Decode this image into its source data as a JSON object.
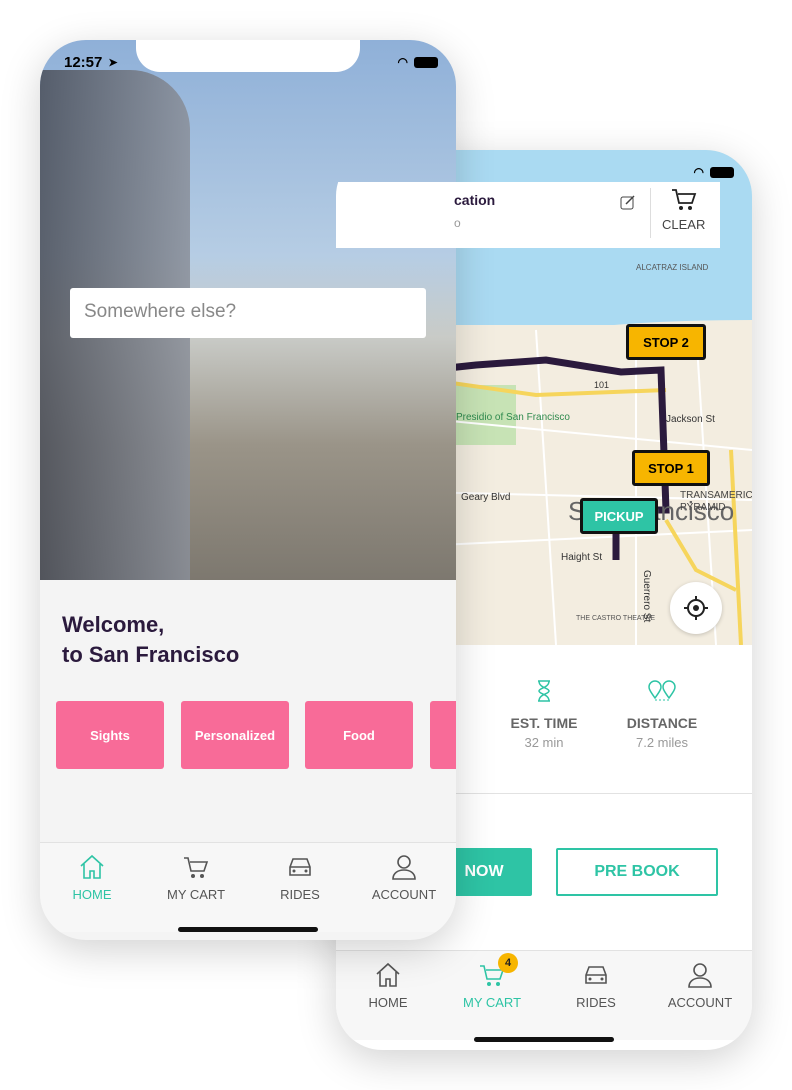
{
  "colors": {
    "accent": "#2ec4a5",
    "pill": "#f86b98",
    "marker_stop": "#f7b500",
    "route": "#2b1a3d"
  },
  "front": {
    "status": {
      "time": "12:57"
    },
    "search": {
      "placeholder": "Somewhere else?"
    },
    "welcome": {
      "line1": "Welcome,",
      "line2": "to San Francisco"
    },
    "categories": [
      "Sights",
      "Personalized",
      "Food"
    ],
    "tabs": [
      {
        "label": "HOME",
        "icon": "home-icon",
        "active": true
      },
      {
        "label": "MY CART",
        "icon": "cart-icon"
      },
      {
        "label": "RIDES",
        "icon": "car-icon"
      },
      {
        "label": "ACCOUNT",
        "icon": "user-icon"
      }
    ]
  },
  "back": {
    "header": {
      "title": "cation",
      "subtitle": "o",
      "clear": "CLEAR"
    },
    "map": {
      "labels": [
        "ALCATRAZ ISLAND",
        "Presidio of San Francisco",
        "Geary Blvd",
        "San Francisco",
        "Haight St",
        "Jackson St",
        "TRANSAMERICA PYRAMID",
        "THE CASTRO THEATRE",
        "Guerrero St",
        "101"
      ]
    },
    "markers": {
      "stop2": "STOP 2",
      "stop1": "STOP 1",
      "pickup": "PICKUP"
    },
    "info": [
      {
        "label": "EST. TIME",
        "value": "32 min",
        "icon": "hourglass-icon"
      },
      {
        "label": "DISTANCE",
        "value": "7.2 miles",
        "icon": "distance-pins-icon"
      }
    ],
    "buttons": {
      "now": "NOW",
      "prebook": "PRE BOOK"
    },
    "cart_badge": "4",
    "tabs": [
      {
        "label": "HOME",
        "icon": "home-icon"
      },
      {
        "label": "MY CART",
        "icon": "cart-icon",
        "active": true
      },
      {
        "label": "RIDES",
        "icon": "car-icon"
      },
      {
        "label": "ACCOUNT",
        "icon": "user-icon"
      }
    ]
  }
}
